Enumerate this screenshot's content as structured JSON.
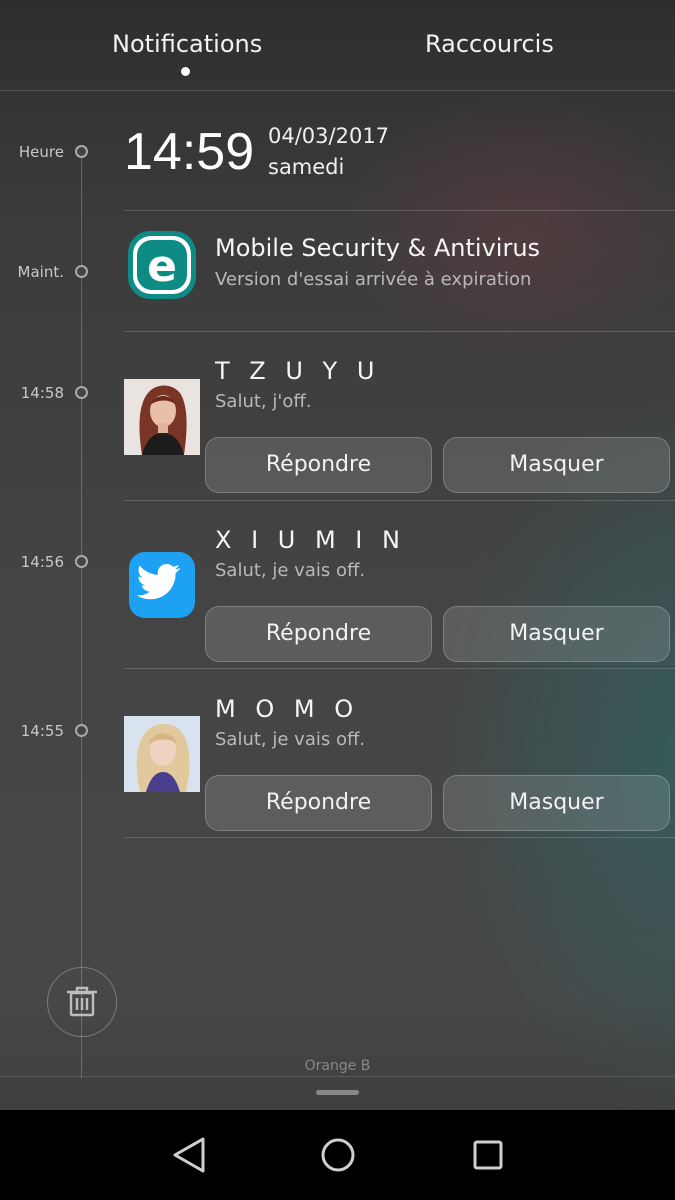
{
  "header": {
    "tabs": [
      {
        "label": "Notifications",
        "active": true
      },
      {
        "label": "Raccourcis",
        "active": false
      }
    ]
  },
  "clock": {
    "label": "Heure",
    "time": "14:59",
    "date": "04/03/2017",
    "day": "samedi"
  },
  "notifications": [
    {
      "time": "Maint.",
      "app_icon": "eset-icon",
      "title": "Mobile Security & Antivirus",
      "text": "Version d'essai arrivée à expiration"
    },
    {
      "time": "14:58",
      "app_icon": "contact-photo",
      "title": "T Z U Y U",
      "text": "Salut, j'off.",
      "reply_label": "Répondre",
      "hide_label": "Masquer"
    },
    {
      "time": "14:56",
      "app_icon": "twitter-icon",
      "title": "X I U M I N",
      "text": "Salut, je vais off.",
      "reply_label": "Répondre",
      "hide_label": "Masquer"
    },
    {
      "time": "14:55",
      "app_icon": "contact-photo",
      "title": "M O M O",
      "text": "Salut, je vais off.",
      "reply_label": "Répondre",
      "hide_label": "Masquer"
    }
  ],
  "footer": {
    "carrier": "Orange B"
  },
  "navbar": {
    "buttons": [
      "back-icon",
      "home-icon",
      "recents-icon"
    ]
  },
  "colors": {
    "eset_accent": "#0f8b86",
    "twitter_blue": "#1da1f2",
    "background": "#404040"
  }
}
